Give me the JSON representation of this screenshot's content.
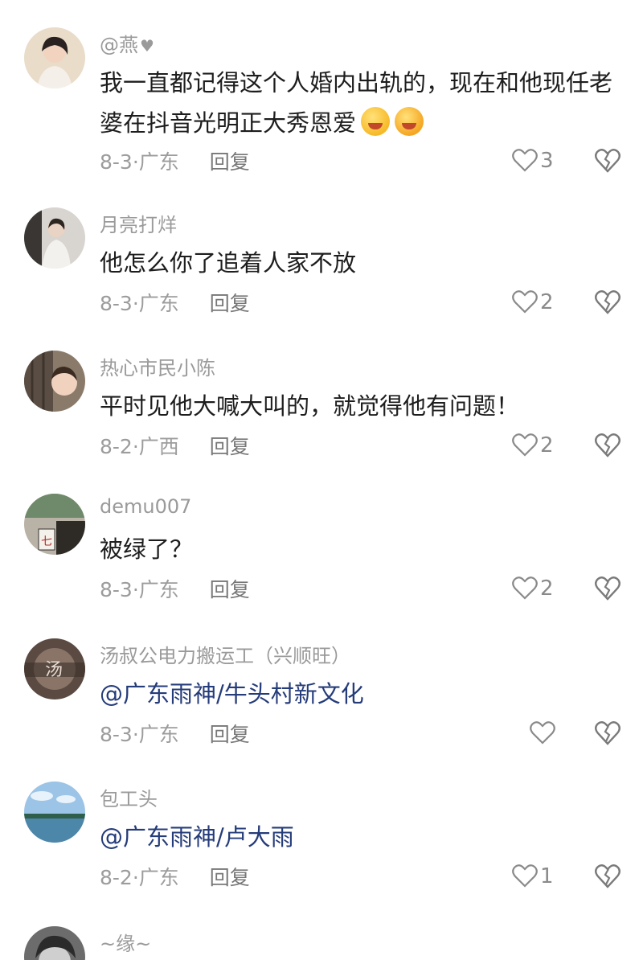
{
  "comments": [
    {
      "username": "@燕",
      "username_suffix": "♥",
      "text": "我一直都记得这个人婚内出轨的，现在和他现任老婆在抖音光明正大秀恩爱",
      "emojis": [
        "kiss-emoji",
        "laughing-crying-emoji"
      ],
      "date_location": "8-3·广东",
      "reply_label": "回复",
      "likes": "3"
    },
    {
      "username": "月亮打烊",
      "text": "他怎么你了追着人家不放",
      "date_location": "8-3·广东",
      "reply_label": "回复",
      "likes": "2"
    },
    {
      "username": "热心市民小陈",
      "text": "平时见他大喊大叫的，就觉得他有问题！",
      "date_location": "8-2·广西",
      "reply_label": "回复",
      "likes": "2"
    },
    {
      "username": "demu007",
      "text": "被绿了？",
      "date_location": "8-3·广东",
      "reply_label": "回复",
      "likes": "2"
    },
    {
      "username": "汤叔公电力搬运工（兴顺旺）",
      "avatar_text": "汤",
      "text": "@广东雨神/牛头村新文化",
      "date_location": "8-3·广东",
      "reply_label": "回复",
      "likes": ""
    },
    {
      "username": "包工头",
      "text": "@广东雨神/卢大雨",
      "date_location": "8-2·广东",
      "reply_label": "回复",
      "likes": "1"
    },
    {
      "username": "~缘~"
    }
  ],
  "icons": {
    "like": "heart-outline-icon",
    "dislike": "broken-heart-icon"
  },
  "colors": {
    "mention": "#253c7a",
    "meta": "#9c9c9c"
  }
}
